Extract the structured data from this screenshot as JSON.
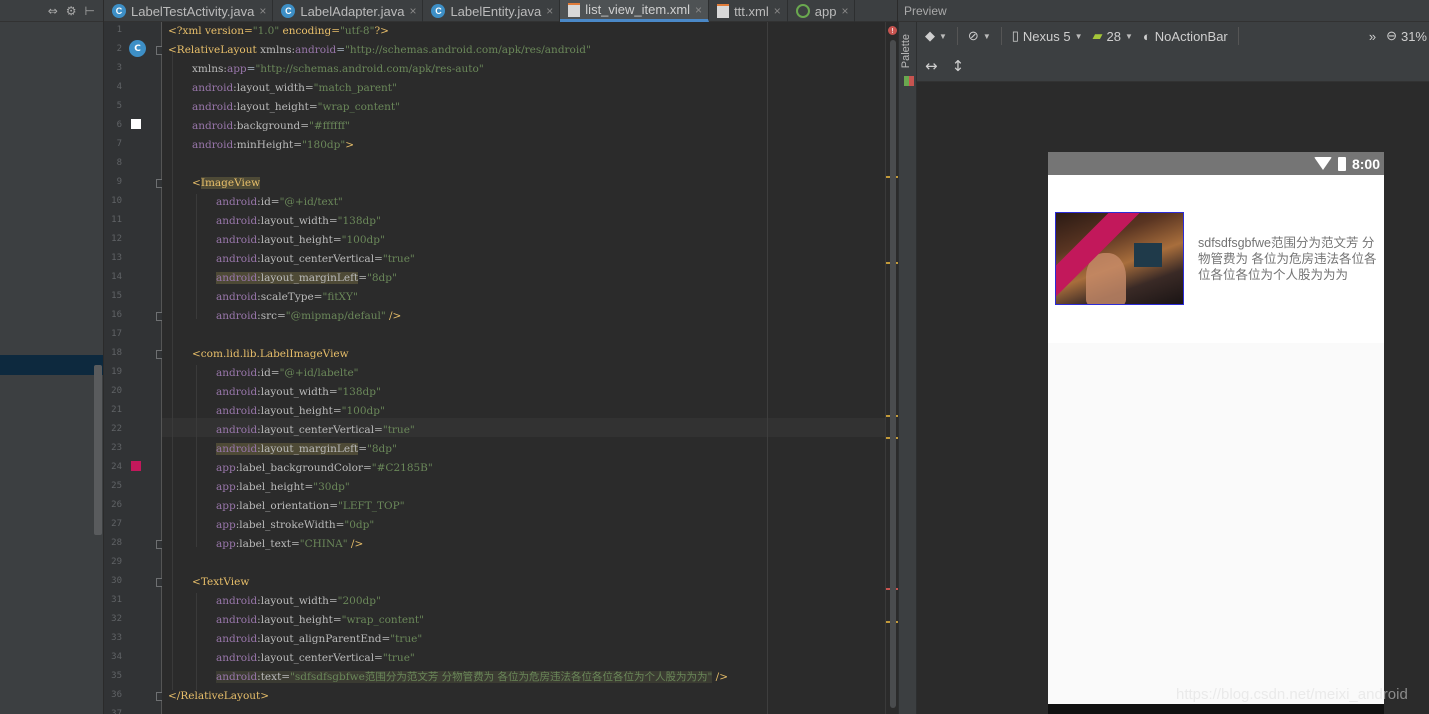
{
  "left_toolbar": {
    "icons": [
      "split-icon",
      "gear-icon",
      "pin-icon"
    ]
  },
  "tabs": [
    {
      "label": "LabelTestActivity.java",
      "icon": "java-class-icon",
      "active": false
    },
    {
      "label": "LabelAdapter.java",
      "icon": "java-class-icon",
      "active": false
    },
    {
      "label": "LabelEntity.java",
      "icon": "java-class-icon",
      "active": false
    },
    {
      "label": "list_view_item.xml",
      "icon": "xml-file-icon",
      "active": true
    },
    {
      "label": "ttt.xml",
      "icon": "xml-file-icon",
      "active": false
    },
    {
      "label": "app",
      "icon": "app-module-icon",
      "active": false
    }
  ],
  "editor": {
    "line_numbers": [
      "1",
      "2",
      "3",
      "4",
      "5",
      "6",
      "7",
      "8",
      "9",
      "10",
      "11",
      "12",
      "13",
      "14",
      "15",
      "16",
      "17",
      "18",
      "19",
      "20",
      "21",
      "22",
      "23",
      "24",
      "25",
      "26",
      "27",
      "28",
      "29",
      "30",
      "31",
      "32",
      "33",
      "34",
      "35",
      "36",
      "37"
    ],
    "colors": {
      "background_swatch": "#ffffff",
      "label_color_swatch": "#C2185B"
    },
    "code": {
      "l1": {
        "a": "<?xml version=",
        "b": "\"1.0\"",
        "c": " encoding=",
        "d": "\"utf-8\"",
        "e": "?>"
      },
      "l2": {
        "a": "<RelativeLayout ",
        "b": "xmlns:",
        "c": "android",
        "d": "=",
        "e": "\"http://schemas.android.com/apk/res/android\""
      },
      "l3": {
        "a": "xmlns:",
        "b": "app",
        "c": "=",
        "d": "\"http://schemas.android.com/apk/res-auto\""
      },
      "l4": {
        "a": "android",
        "b": ":layout_width=",
        "c": "\"match_parent\""
      },
      "l5": {
        "a": "android",
        "b": ":layout_height=",
        "c": "\"wrap_content\""
      },
      "l6": {
        "a": "android",
        "b": ":background=",
        "c": "\"#ffffff\""
      },
      "l7": {
        "a": "android",
        "b": ":minHeight=",
        "c": "\"180dp\"",
        "d": ">"
      },
      "l9": {
        "a": "<",
        "b": "ImageView"
      },
      "l10": {
        "a": "android",
        "b": ":id=",
        "c": "\"@+id/text\""
      },
      "l11": {
        "a": "android",
        "b": ":layout_width=",
        "c": "\"138dp\""
      },
      "l12": {
        "a": "android",
        "b": ":layout_height=",
        "c": "\"100dp\""
      },
      "l13": {
        "a": "android",
        "b": ":layout_centerVertical=",
        "c": "\"true\""
      },
      "l14": {
        "a": "android",
        "b": ":layout_marginLeft",
        "c": "=",
        "d": "\"8dp\""
      },
      "l15": {
        "a": "android",
        "b": ":scaleType=",
        "c": "\"fitXY\""
      },
      "l16": {
        "a": "android",
        "b": ":src=",
        "c": "\"@mipmap/defaul\"",
        "d": " />"
      },
      "l18": {
        "a": "<com.lid.lib.LabelImageView"
      },
      "l19": {
        "a": "android",
        "b": ":id=",
        "c": "\"@+id/labelte\""
      },
      "l20": {
        "a": "android",
        "b": ":layout_width=",
        "c": "\"138dp\""
      },
      "l21": {
        "a": "android",
        "b": ":layout_height=",
        "c": "\"100dp\""
      },
      "l22": {
        "a": "android",
        "b": ":layout_centerVertical=",
        "c": "\"true\""
      },
      "l23": {
        "a": "android",
        "b": ":layout_marginLeft",
        "c": "=",
        "d": "\"8dp\""
      },
      "l24": {
        "a": "app",
        "b": ":label_backgroundColor=",
        "c": "\"#C2185B\""
      },
      "l25": {
        "a": "app",
        "b": ":label_height=",
        "c": "\"30dp\""
      },
      "l26": {
        "a": "app",
        "b": ":label_orientation=",
        "c": "\"LEFT_TOP\""
      },
      "l27": {
        "a": "app",
        "b": ":label_strokeWidth=",
        "c": "\"0dp\""
      },
      "l28": {
        "a": "app",
        "b": ":label_text=",
        "c": "\"CHINA\"",
        "d": " />"
      },
      "l30": {
        "a": "<",
        "b": "TextView"
      },
      "l31": {
        "a": "android",
        "b": ":layout_width=",
        "c": "\"200dp\""
      },
      "l32": {
        "a": "android",
        "b": ":layout_height=",
        "c": "\"wrap_content\""
      },
      "l33": {
        "a": "android",
        "b": ":layout_alignParentEnd=",
        "c": "\"true\""
      },
      "l34": {
        "a": "android",
        "b": ":layout_centerVertical=",
        "c": "\"true\""
      },
      "l35": {
        "a": "android",
        "b": ":text=",
        "c": "\"sdfsdfsgbfwe范围分为范文芳 分物管费为 各位为危房违法各位各位各位为个人股为为为\"",
        "d": " />"
      },
      "l36": {
        "a": "</",
        "b": "RelativeLayout",
        "c": ">"
      }
    }
  },
  "palette": {
    "label": "Palette"
  },
  "preview": {
    "title": "Preview",
    "device": "Nexus 5",
    "api_level": "28",
    "theme": "NoActionBar",
    "more": "»",
    "zoom": "31%",
    "status_time": "8:00",
    "list_text": "sdfsdfsgbfwe范围分为范文芳 分物管费为 各位为危房违法各位各位各位各位为个人股为为为"
  },
  "watermark": "https://blog.csdn.net/meixi_android"
}
